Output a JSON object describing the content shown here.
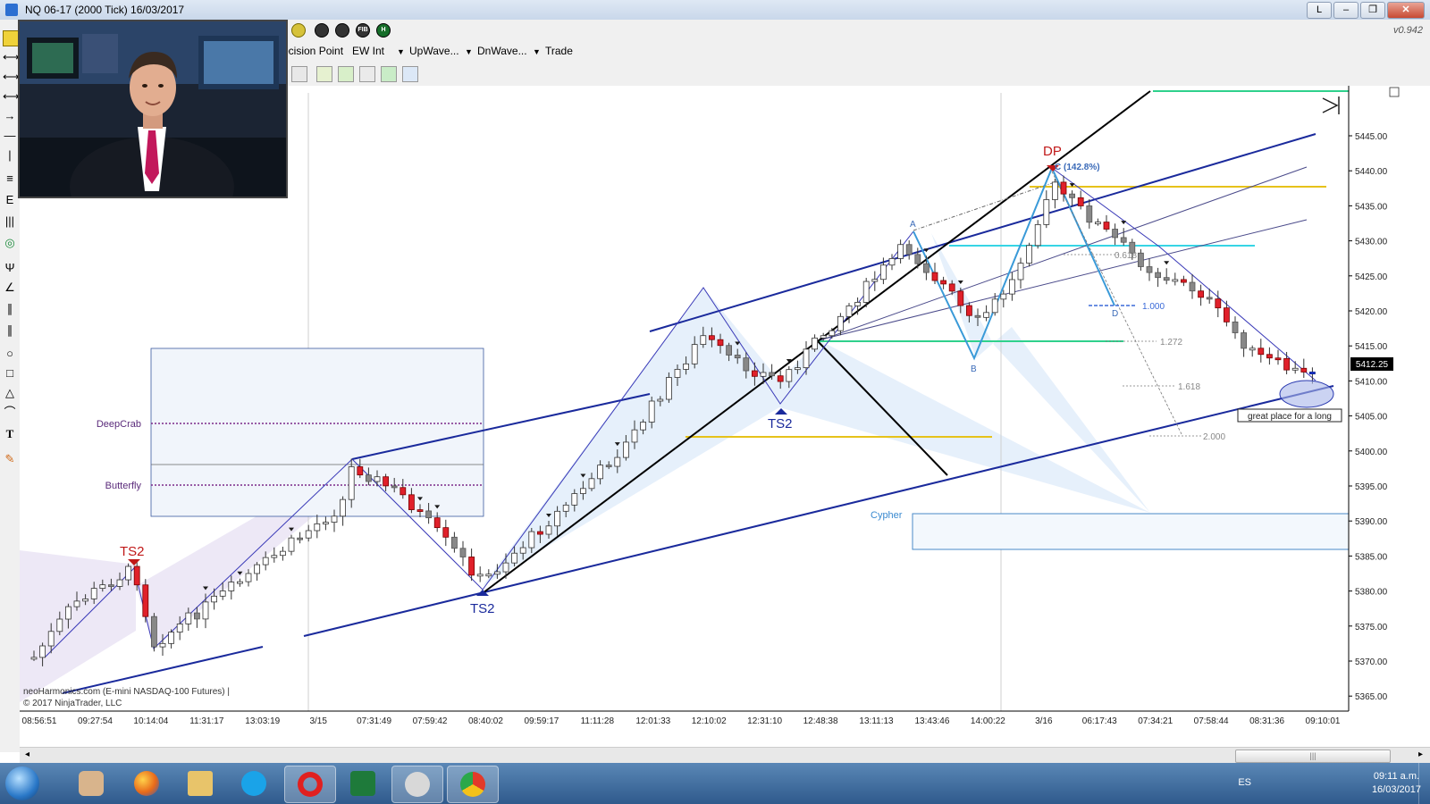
{
  "window": {
    "title": "NQ 06-17 (2000 Tick)  16/03/2017",
    "buttons": [
      "L",
      "–",
      "❐",
      "✕"
    ]
  },
  "toolbar": {
    "version": "v0.942",
    "menu": [
      {
        "label": "ecision Point",
        "dropdown": false
      },
      {
        "label": "EW Int",
        "dropdown": true
      },
      {
        "label": "UpWave...",
        "dropdown": true
      },
      {
        "label": "DnWave...",
        "dropdown": true
      },
      {
        "label": "Trade",
        "dropdown": false
      }
    ],
    "round_icons": [
      "",
      "",
      "",
      "FIB",
      "H"
    ]
  },
  "chart": {
    "price_axis": [
      "5445.00",
      "5440.00",
      "5435.00",
      "5430.00",
      "5425.00",
      "5420.00",
      "5415.00",
      "5410.00",
      "5405.00",
      "5400.00",
      "5395.00",
      "5390.00",
      "5385.00",
      "5380.00",
      "5375.00",
      "5370.00",
      "5365.00"
    ],
    "last_price": "5412.25",
    "time_axis": [
      "08:56:51",
      "09:27:54",
      "10:14:04",
      "11:31:17",
      "13:03:19",
      "3/15",
      "07:31:49",
      "07:59:42",
      "08:40:02",
      "09:59:17",
      "11:11:28",
      "12:01:33",
      "12:10:02",
      "12:31:10",
      "12:48:38",
      "13:11:13",
      "13:43:46",
      "14:00:22",
      "3/16",
      "06:17:43",
      "07:34:21",
      "07:58:44",
      "08:31:36",
      "09:10:01"
    ],
    "labels": {
      "deepcrab": "DeepCrab",
      "butterfly": "Butterfly",
      "cypher": "Cypher",
      "ts2_a": "TS2",
      "ts2_b": "TS2",
      "ts2_c": "TS2",
      "dp": "DP",
      "c_pct": "C (142.8%)",
      "pt_a": "A",
      "pt_b": "B",
      "pt_d": "D",
      "fib_0618": "0.618",
      "fib_1000": "1.000",
      "fib_1272": "1.272",
      "fib_1618": "1.618",
      "fib_2000": "2.000",
      "annotation": "great place for a long",
      "footer1": "neoHarmonics.com (E-mini NASDAQ-100 Futures)   |",
      "footer2": "© 2017 NinjaTrader, LLC"
    }
  },
  "taskbar": {
    "apps": [
      "explorer-hand",
      "firefox",
      "folder",
      "skype",
      "opera",
      "excel",
      "ninjatrader",
      "chrome"
    ],
    "lang": "ES",
    "time": "09:11 a.m.",
    "date": "16/03/2017"
  },
  "colors": {
    "bull": "#ffffff",
    "bear": "#e0202a",
    "neutral": "#888888",
    "blue": "#1a2a9c",
    "cyan": "#37d5e5",
    "gold": "#e6c21a",
    "green": "#2fd18c"
  }
}
